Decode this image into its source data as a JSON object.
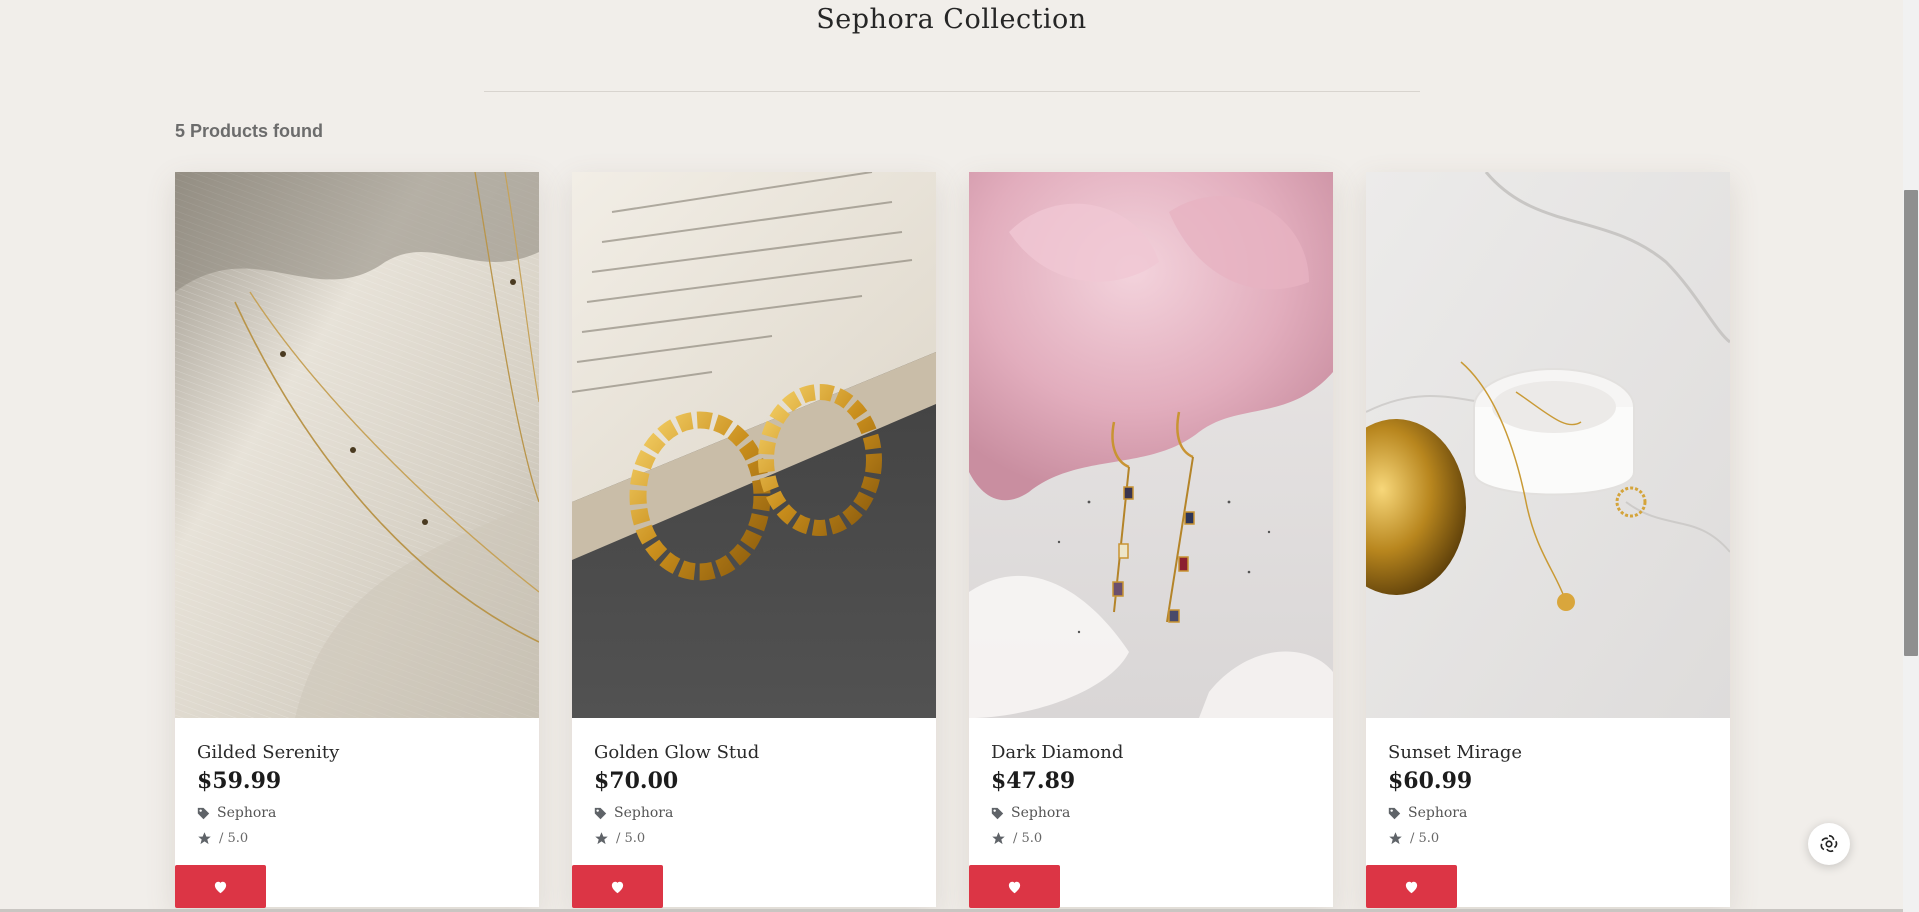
{
  "page": {
    "title": "Sephora Collection",
    "results_count": "5 Products found"
  },
  "products": [
    {
      "name": "Gilded Serenity",
      "price": "$59.99",
      "brand": "Sephora",
      "rating_label": "/ 5.0",
      "brand_icon": "tag-icon",
      "rating_icon": "star-icon",
      "favorite_icon": "heart-icon"
    },
    {
      "name": "Golden Glow Stud",
      "price": "$70.00",
      "brand": "Sephora",
      "rating_label": "/ 5.0",
      "brand_icon": "tag-icon",
      "rating_icon": "star-icon",
      "favorite_icon": "heart-icon"
    },
    {
      "name": "Dark Diamond",
      "price": "$47.89",
      "brand": "Sephora",
      "rating_label": "/ 5.0",
      "brand_icon": "tag-icon",
      "rating_icon": "star-icon",
      "favorite_icon": "heart-icon"
    },
    {
      "name": "Sunset Mirage",
      "price": "$60.99",
      "brand": "Sephora",
      "rating_label": "/ 5.0",
      "brand_icon": "tag-icon",
      "rating_icon": "star-icon",
      "favorite_icon": "heart-icon"
    }
  ],
  "colors": {
    "background": "#f1eeea",
    "favorite_button": "#dc3545",
    "icon_gray": "#5f6368"
  },
  "chat_widget": {
    "icon": "chat-assistant-icon"
  }
}
